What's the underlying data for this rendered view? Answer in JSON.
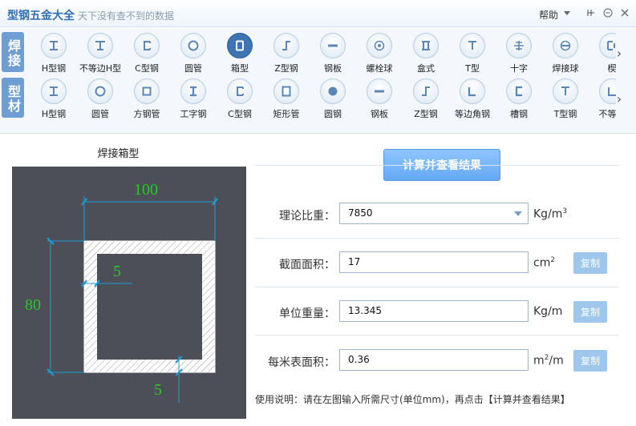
{
  "app": {
    "title": "型钢五金大全",
    "slogan": "天下没有查不到的数据",
    "help_label": "帮助"
  },
  "toolbar": {
    "row1_label": "焊接",
    "row2_label": "型材",
    "row1_items": [
      {
        "label": "H型钢",
        "icon": "h-beam-icon"
      },
      {
        "label": "不等边H型",
        "icon": "unequal-h-beam-icon"
      },
      {
        "label": "C型钢",
        "icon": "c-channel-icon"
      },
      {
        "label": "圆管",
        "icon": "round-tube-icon"
      },
      {
        "label": "箱型",
        "icon": "box-section-icon",
        "active": true
      },
      {
        "label": "Z型钢",
        "icon": "z-section-icon"
      },
      {
        "label": "钢板",
        "icon": "steel-plate-icon"
      },
      {
        "label": "螺栓球",
        "icon": "bolt-ball-icon"
      },
      {
        "label": "盒式",
        "icon": "box-type-icon"
      },
      {
        "label": "T型",
        "icon": "t-section-icon"
      },
      {
        "label": "十字",
        "icon": "cross-section-icon"
      },
      {
        "label": "焊接球",
        "icon": "welded-ball-icon"
      },
      {
        "label": "楔",
        "icon": "wedge-icon"
      }
    ],
    "row2_items": [
      {
        "label": "H型钢",
        "icon": "h-beam-icon"
      },
      {
        "label": "圆管",
        "icon": "round-tube-icon"
      },
      {
        "label": "方钢管",
        "icon": "square-tube-icon"
      },
      {
        "label": "工字钢",
        "icon": "i-beam-icon"
      },
      {
        "label": "C型钢",
        "icon": "c-channel-icon"
      },
      {
        "label": "矩形管",
        "icon": "rect-tube-icon"
      },
      {
        "label": "圆钢",
        "icon": "round-bar-icon"
      },
      {
        "label": "钢板",
        "icon": "steel-plate-icon"
      },
      {
        "label": "Z型钢",
        "icon": "z-section-icon"
      },
      {
        "label": "等边角钢",
        "icon": "equal-angle-icon"
      },
      {
        "label": "槽钢",
        "icon": "channel-icon"
      },
      {
        "label": "T型钢",
        "icon": "t-section-icon"
      },
      {
        "label": "不等边",
        "icon": "unequal-angle-icon"
      }
    ]
  },
  "diagram": {
    "title": "焊接箱型",
    "width_label": "100",
    "height_label": "80",
    "wall_thickness_label": "5",
    "flange_thickness_label": "5"
  },
  "form": {
    "calc_button": "计算并查看结果",
    "density_label": "理论比重：",
    "density_value": "7850",
    "density_unit": "Kg/m",
    "density_unit_sup": "3",
    "area_label": "截面面积：",
    "area_value": "17",
    "area_unit": "cm",
    "area_unit_sup": "2",
    "weight_label": "单位重量：",
    "weight_value": "13.345",
    "weight_unit": "Kg/m",
    "surface_label": "每米表面积：",
    "surface_value": "0.36",
    "surface_unit_pre": "m",
    "surface_unit_sup": "2",
    "surface_unit_post": "/m",
    "copy_label": "复制"
  },
  "usage_text": "使用说明：请在左图输入所需尺寸(单位mm)，再点击【计算并查看结果】",
  "colors": {
    "accent": "#2f6fb6",
    "button": "#64a9f4",
    "diagram_bg": "#4c4f57",
    "dimension_text": "#22cc22",
    "dimension_line": "#1e9bd7"
  }
}
